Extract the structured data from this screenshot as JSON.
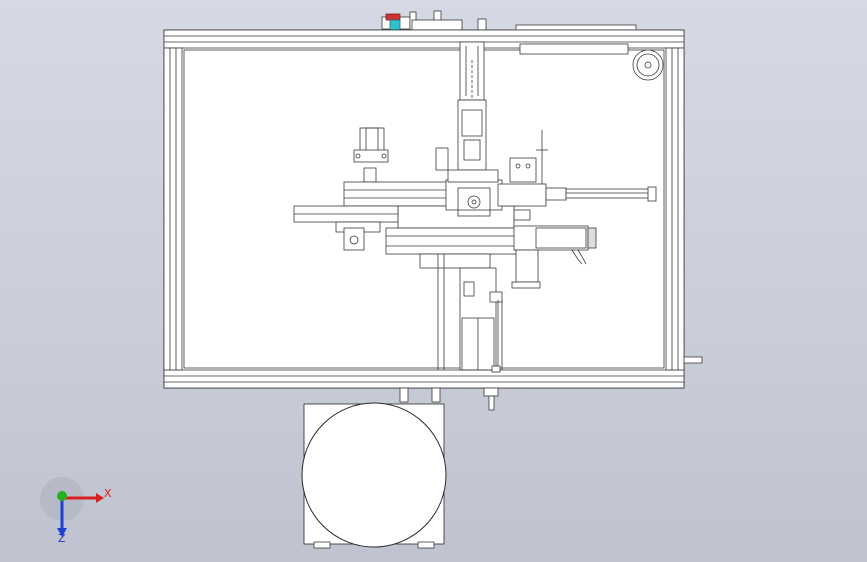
{
  "viewport": {
    "background_color": "#c9cdd9",
    "line_color": "#3a3a3a",
    "body_fill": "#ffffff"
  },
  "triad": {
    "x_label": "X",
    "z_label": "Z",
    "x_color": "#d82020",
    "y_color": "#20b020",
    "z_color": "#2040d0"
  },
  "accents": {
    "red_knob": "#d03030",
    "cyan_fitting": "#30c0d0"
  }
}
